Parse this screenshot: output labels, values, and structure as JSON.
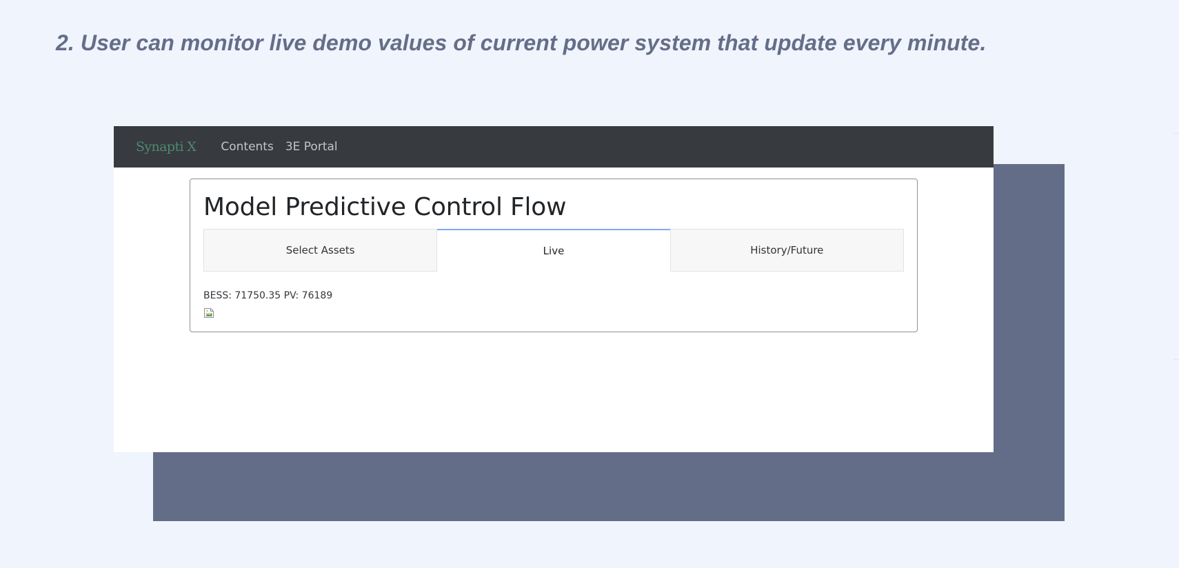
{
  "caption": "2. User can monitor live demo values of current power system that update every minute.",
  "app": {
    "brand": "Synapti X",
    "nav": {
      "contents": "Contents",
      "portal": "3E Portal"
    }
  },
  "card": {
    "title": "Model Predictive Control Flow",
    "tabs": [
      {
        "label": "Select Assets",
        "active": false
      },
      {
        "label": "Live",
        "active": true
      },
      {
        "label": "History/Future",
        "active": false
      }
    ],
    "readout": "BESS: 71750.35 PV: 76189",
    "image_icon": "broken-image-icon"
  },
  "colors": {
    "background": "#f0f4fd",
    "caption": "#656e88",
    "shadow_block": "#646d88",
    "navbar": "#373a3f",
    "brand": "#4e8b70",
    "active_tab_accent": "#7fa9f3"
  }
}
